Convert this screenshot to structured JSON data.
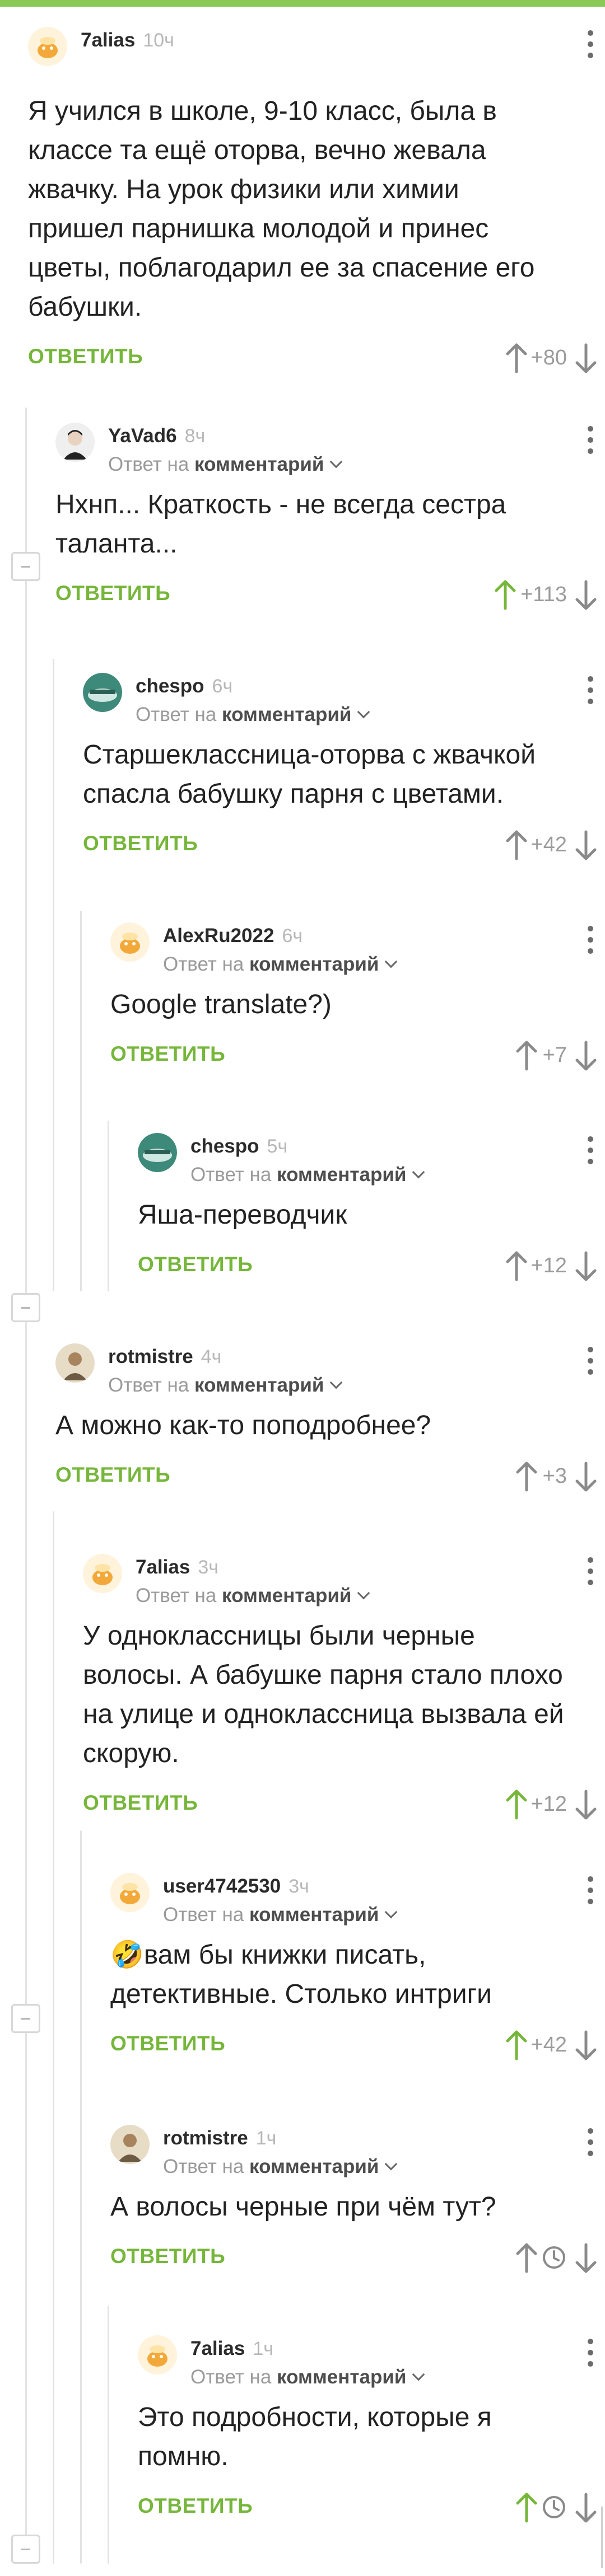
{
  "colors": {
    "accent": "#76b63a",
    "vote_up_active": "#76b63a",
    "text": "#222222",
    "muted": "#9a9a9a"
  },
  "reply_to_prefix": "Ответ на",
  "reply_to_link": "комментарий",
  "reply_label": "ОТВЕТИТЬ",
  "comments": [
    {
      "author": "7alias",
      "time": "10ч",
      "text": "Я учился в школе, 9-10 класс, была в классе та ещё оторва, вечно жевала жвачку. На урок физики или химии пришел парнишка молодой и принес цветы, поблагодарил ее за спасение его бабушки.",
      "score": "+80"
    },
    {
      "author": "YaVad6",
      "time": "8ч",
      "text": "Нхнп... Краткость - не всегда сестра таланта...",
      "score": "+113"
    },
    {
      "author": "chespo",
      "time": "6ч",
      "text": "Старшеклассница-оторва с жвачкой спасла бабушку парня с цветами.",
      "score": "+42"
    },
    {
      "author": "AlexRu2022",
      "time": "6ч",
      "text": "Google translate?)",
      "score": "+7"
    },
    {
      "author": "chespo",
      "time": "5ч",
      "text": "Яша-переводчик",
      "score": "+12"
    },
    {
      "author": "rotmistre",
      "time": "4ч",
      "text": "А можно как-то поподробнее?",
      "score": "+3"
    },
    {
      "author": "7alias",
      "time": "3ч",
      "text": "У одноклассницы были черные волосы. А бабушке парня стало плохо на улице и одноклассница вызвала ей скорую.",
      "score": "+12"
    },
    {
      "author": "user4742530",
      "time": "3ч",
      "text": "🤣вам бы книжки писать, детективные. Столько интриги",
      "score": "+42"
    },
    {
      "author": "rotmistre",
      "time": "1ч",
      "text": "А волосы черные при чём тут?",
      "score": ""
    },
    {
      "author": "7alias",
      "time": "1ч",
      "text": "Это подробности, которые я помню.",
      "score": ""
    }
  ]
}
